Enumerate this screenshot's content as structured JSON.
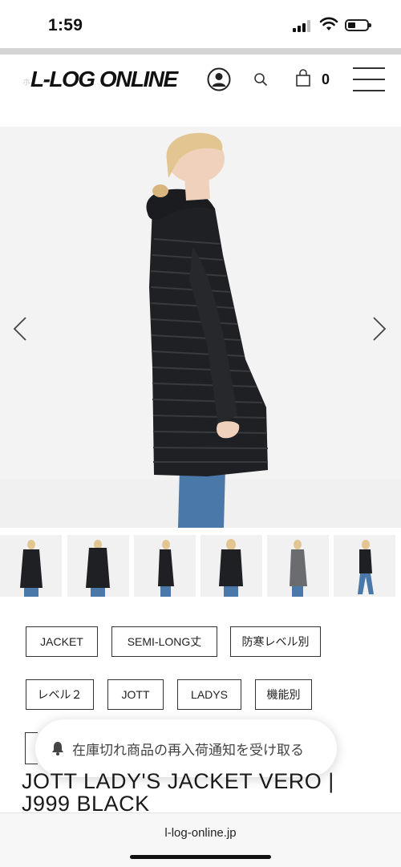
{
  "status_bar": {
    "time": "1:59"
  },
  "header": {
    "logo": "L-LOG ONLINE",
    "cart_count": "0",
    "breadcrumb_partial": "ホ"
  },
  "tags": [
    "JACKET",
    "SEMI-LONG丈",
    "防寒レベル別",
    "レベル２",
    "JOTT",
    "LADYS",
    "機能別"
  ],
  "restock_toast": {
    "text": "在庫切れ商品の再入荷通知を受け取る"
  },
  "product": {
    "title": "JOTT LADY'S JACKET VERO |\nJ999 BLACK"
  },
  "browser": {
    "url": "l-log-online.jp"
  },
  "colors": {
    "coat": "#1f2023",
    "jeans": "#4a78a8",
    "hair": "#e3c591",
    "skin": "#f0d2bc",
    "hero_bg": "#f3f3f3"
  }
}
